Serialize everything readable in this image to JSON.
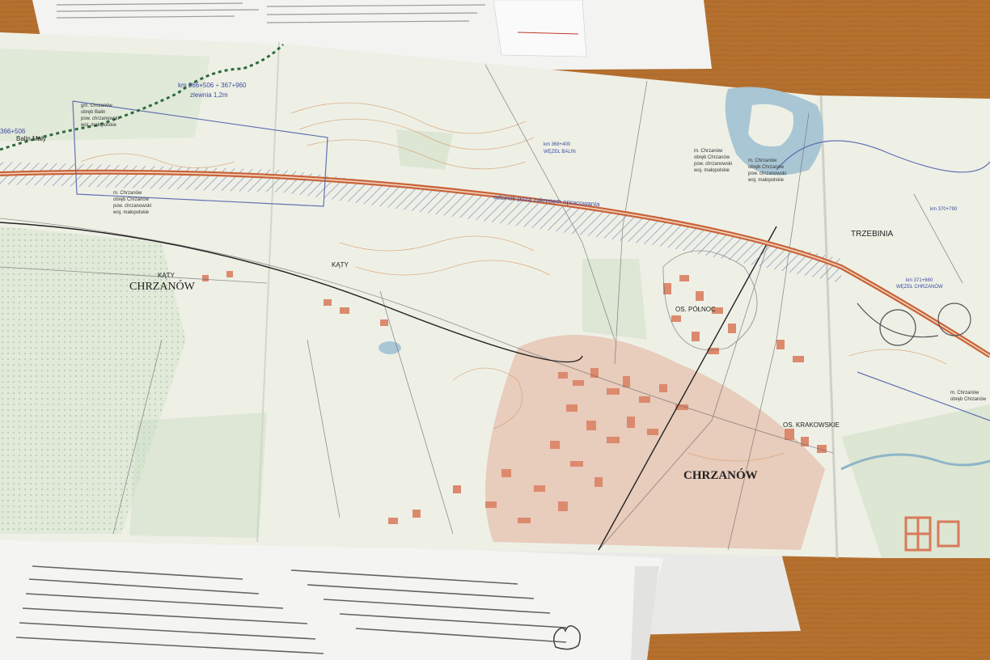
{
  "scene": {
    "background_desk_color": "#b5702e",
    "map_paper_color": "#eef0e6",
    "road_color": "#c8643a",
    "urban_color": "#d9795a",
    "water_color": "#a9c6d4",
    "forest_color": "#c9dcc0"
  },
  "map": {
    "towns": {
      "chrzanow_left": "CHRZANÓW",
      "chrzanow_main": "CHRZANÓW",
      "trzebinia": "TRZEBINIA",
      "katy_left": "KĄTY",
      "katy_center": "KĄTY",
      "balin": "Balin Mały",
      "os_pol": "OS. PÓŁNOC",
      "os_krak": "OS. KRAKOWSKIE"
    },
    "annotations": {
      "km_top": "km 366+506 ÷ 367+960",
      "zlewnia": "zlewnia 1,2m",
      "km_left": "366+506",
      "wezel_balin_km": "km 368+400",
      "wezel_balin": "WĘZEŁ BALIN",
      "odcinek": "odcinek poza zakresem opracowania",
      "wezel_chrz_km": "km 371+660",
      "wezel_chrz": "WĘZEŁ CHRZANÓW",
      "km_right": "km 370+790"
    },
    "admin_blocks": {
      "left": [
        "gm. Chrzanów",
        "obręb Balin",
        "pow. chrzanowski",
        "woj. małopolskie"
      ],
      "mid": [
        "m. Chrzanów",
        "obręb Chrzanów",
        "pow. chrzanowski",
        "woj. małopolskie"
      ],
      "center": [
        "m. Chrzanów",
        "obręb Chrzanów",
        "pow. chrzanowski",
        "woj. małopolskie"
      ],
      "right": [
        "m. Chrzanów",
        "obręb Chrzanów",
        "pow. chrzanowski",
        "woj. małopolskie"
      ],
      "far_right": [
        "m. Chrzanów",
        "obręb Chrzanów"
      ]
    }
  }
}
